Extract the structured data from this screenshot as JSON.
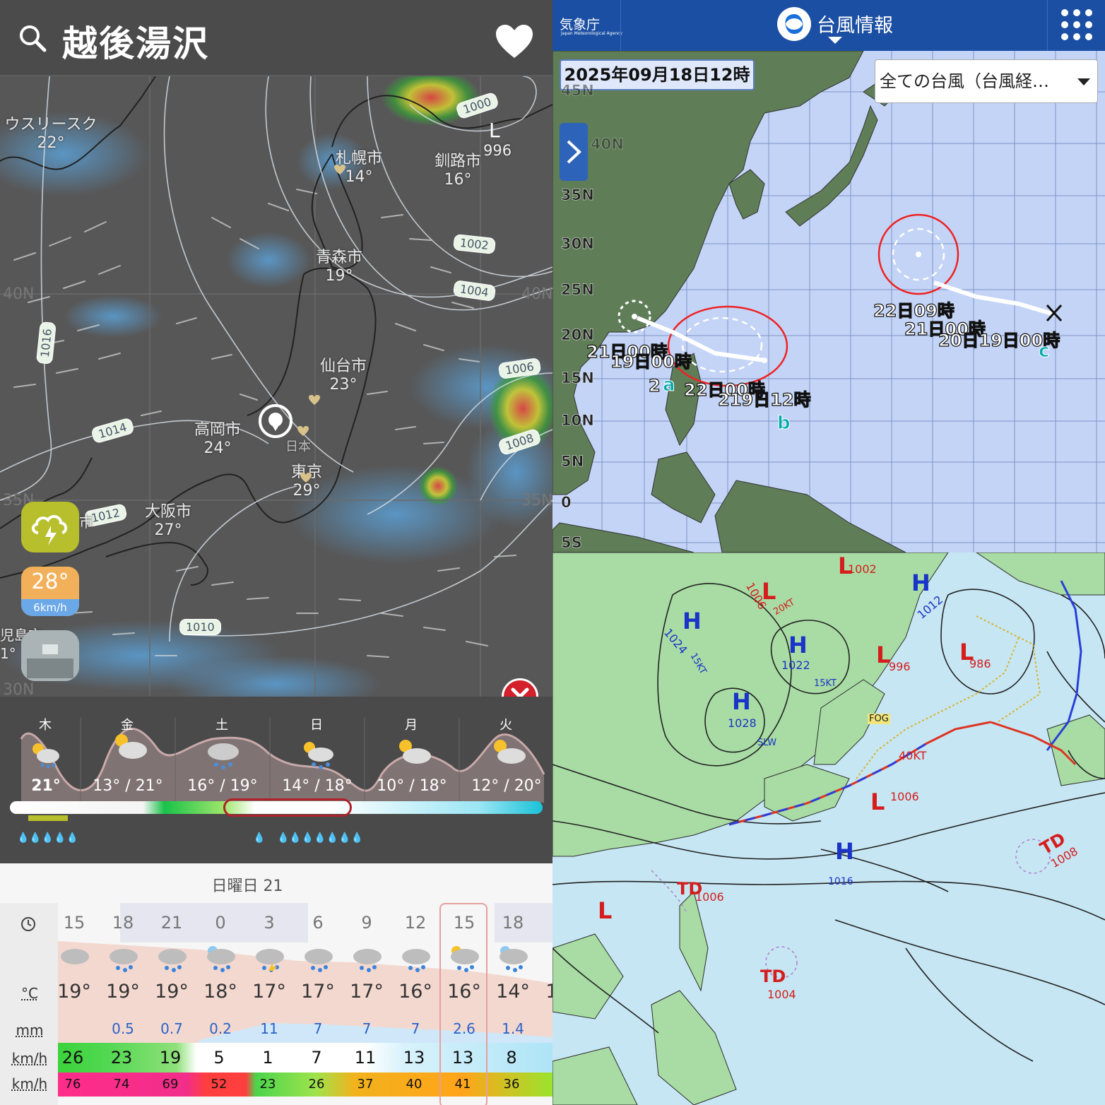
{
  "left": {
    "search": {
      "city": "越後湯沢"
    },
    "map": {
      "cities": [
        {
          "name": "ウスリースク",
          "temp": "22°"
        },
        {
          "name": "札幌市",
          "temp": "14°"
        },
        {
          "name": "釧路市",
          "temp": "16°"
        },
        {
          "name": "青森市",
          "temp": "19°"
        },
        {
          "name": "仙台市",
          "temp": "23°"
        },
        {
          "name": "高岡市",
          "temp": "24°"
        },
        {
          "name": "東京",
          "temp": "29°"
        },
        {
          "name": "大阪市",
          "temp": "27°"
        }
      ],
      "isobars": [
        "1000",
        "996",
        "1002",
        "1004",
        "1006",
        "1008",
        "1014",
        "1016",
        "1012",
        "1010"
      ],
      "low_mark": "L",
      "japan_label": "日本",
      "lat_labels": [
        "40N",
        "40N",
        "35N",
        "35N",
        "30N"
      ],
      "side_fragments": [
        "市",
        "児島市",
        "1°"
      ]
    },
    "badge": {
      "temp": "28°",
      "wind": "6km/h"
    },
    "forecast": {
      "days": [
        {
          "name": "木",
          "range": "21°"
        },
        {
          "name": "金",
          "range": "13° / 21°"
        },
        {
          "name": "土",
          "range": "16° / 19°"
        },
        {
          "name": "日",
          "range": "14° / 18°"
        },
        {
          "name": "月",
          "range": "10° / 18°"
        },
        {
          "name": "火",
          "range": "12° / 20°"
        }
      ],
      "drops1": "💧💧💧💧💧",
      "drops2": "💧",
      "drops3": "💧💧💧💧💧💧💧"
    },
    "hourly": {
      "date": "日曜日 21",
      "hours": [
        "15",
        "18",
        "21",
        "0",
        "3",
        "6",
        "9",
        "12",
        "15",
        "18"
      ],
      "temps": [
        "19°",
        "19°",
        "19°",
        "18°",
        "17°",
        "17°",
        "17°",
        "16°",
        "16°",
        "14°"
      ],
      "rain": [
        "",
        "0.5",
        "0.7",
        "0.2",
        "11",
        "7",
        "7",
        "7",
        "2.6",
        "1.4"
      ],
      "wind": [
        "26",
        "23",
        "19",
        "5",
        "1",
        "7",
        "11",
        "13",
        "13",
        "8"
      ],
      "gust": [
        "76",
        "74",
        "69",
        "52",
        "23",
        "26",
        "37",
        "40",
        "41",
        "36"
      ],
      "row_labels": {
        "temp": "°C",
        "rain": "mm",
        "wind": "km/h",
        "gust": "km/h"
      },
      "overflow_temp": "1"
    }
  },
  "top_right": {
    "header": {
      "logo": "気象庁",
      "logo_sub": "Japan Meteorological Agency",
      "title": "台風情報"
    },
    "date": "2025年09月18日12時",
    "select": "全ての台風（台風経…",
    "lat_labels": [
      "45N",
      "40N",
      "35N",
      "30N",
      "25N",
      "20N",
      "15N",
      "10N",
      "5N",
      "0",
      "5S"
    ],
    "typhoon_labels": {
      "a1": "21日00時",
      "a2": "19日00時",
      "a3": "2",
      "a4": "22日00時",
      "a5": "219日12時",
      "c1": "22日09時",
      "c2": "21日00時",
      "c3": "20日19日00時"
    },
    "letters": [
      "a",
      "b",
      "c"
    ]
  },
  "bottom_right": {
    "highs": [
      "H",
      "H",
      "H",
      "H",
      "H"
    ],
    "lows": [
      "L",
      "L",
      "L",
      "L",
      "L",
      "L"
    ],
    "td": [
      "TD",
      "TD",
      "TD"
    ],
    "values": {
      "h1": "1024",
      "h2": "1022",
      "h3": "1028",
      "h4": "1016",
      "h5": "1012",
      "l1": "1006",
      "l2": "996",
      "l3": "1002",
      "l4": "1006",
      "l5": "986",
      "td1": "1006",
      "td2": "1004",
      "td3": "1008",
      "w1": "15KT",
      "w2": "15KT",
      "w3": "40KT",
      "w4": "20KT",
      "w5": "SLW",
      "fog": "FOG"
    }
  }
}
